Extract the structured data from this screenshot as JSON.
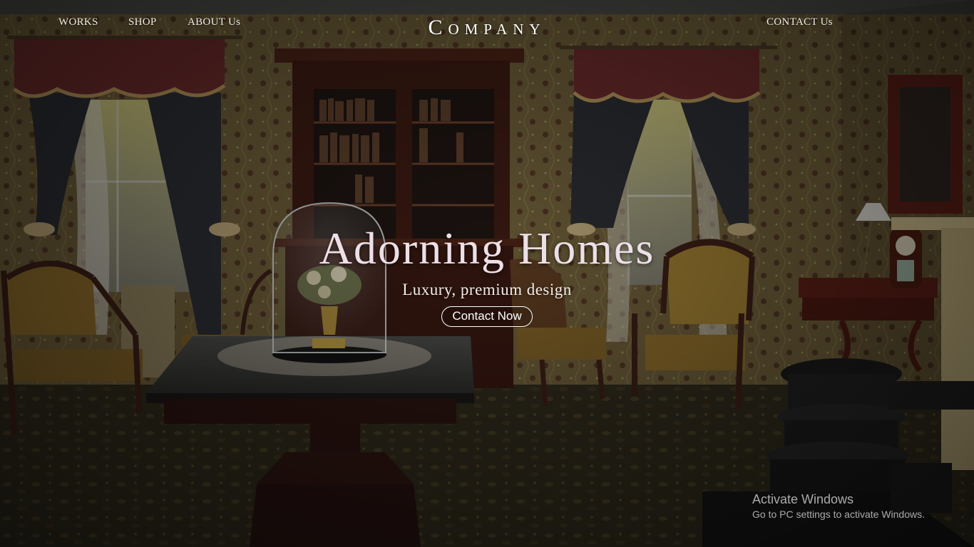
{
  "nav": {
    "works": "WORKS",
    "shop": "SHOP",
    "about": "ABOUT Us",
    "contact": "CONTACT Us"
  },
  "brand": {
    "logo": "Company"
  },
  "hero": {
    "title": "Adorning Homes",
    "subtitle": "Luxury, premium design",
    "cta": "Contact Now"
  },
  "watermark": {
    "title": "Activate Windows",
    "subtitle": "Go to PC settings to activate Windows."
  },
  "colors": {
    "wallpaper": "#6e5f3a",
    "valance": "#6a2a2a",
    "curtain": "#2c2c30",
    "wood": "#3b1e16",
    "chair": "#8a6a2a",
    "text": "#ecdfe6"
  }
}
